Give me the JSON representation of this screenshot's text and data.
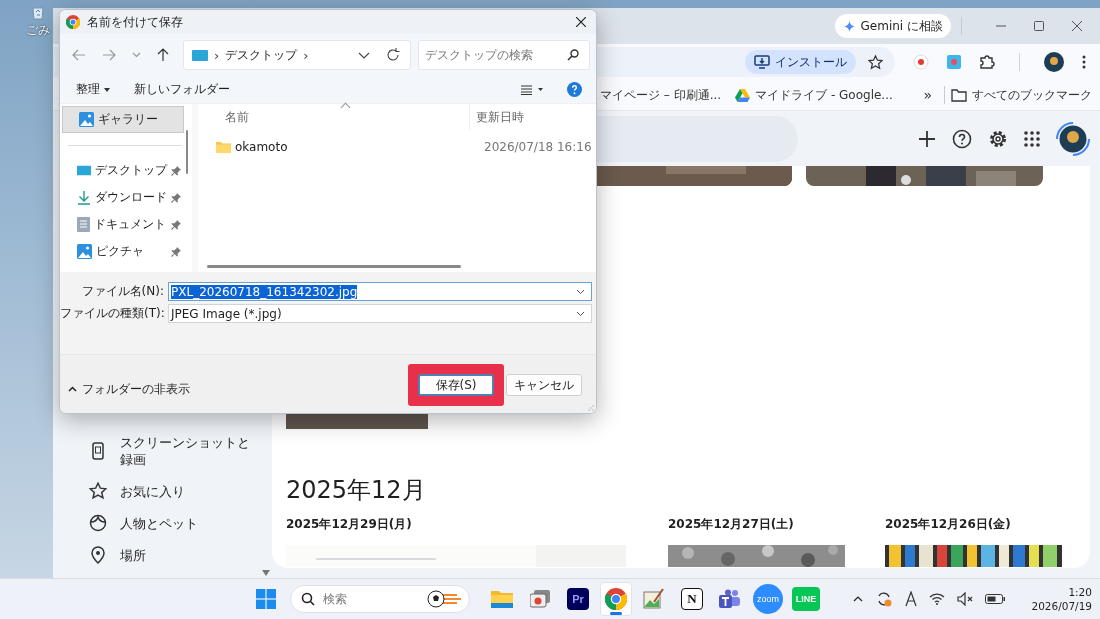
{
  "desktop": {
    "icon_label": "ごみ"
  },
  "browser": {
    "gemini_button": "Gemini に相談",
    "install_button": "インストール",
    "bookmarks": [
      {
        "label": "マイページ – 印刷通...",
        "kind": "page"
      },
      {
        "label": "マイドライブ - Google...",
        "kind": "drive"
      }
    ],
    "overflow": "»",
    "all_bookmarks": "すべてのブックマーク"
  },
  "photos": {
    "sidebar": [
      {
        "label": "スクリーンショットと録画",
        "kind": "screenshot"
      },
      {
        "label": "お気に入り",
        "kind": "favorite"
      },
      {
        "label": "人物とペット",
        "kind": "people"
      },
      {
        "label": "場所",
        "kind": "place"
      }
    ],
    "month": "2025年12月",
    "days": [
      "2025年12月29日(月)",
      "2025年12月27日(土)",
      "2025年12月26日(金)"
    ]
  },
  "dialog": {
    "title": "名前を付けて保存",
    "breadcrumb": [
      "›",
      "デスクトップ",
      "›"
    ],
    "search_placeholder": "デスクトップの検索",
    "organize": "整理",
    "new_folder": "新しいフォルダー",
    "nav": [
      {
        "label": "ギャラリー",
        "kind": "gallery",
        "selected": true,
        "pinned": false
      },
      {
        "label": "デスクトップ",
        "kind": "desktop",
        "selected": false,
        "pinned": true
      },
      {
        "label": "ダウンロード",
        "kind": "download",
        "selected": false,
        "pinned": true
      },
      {
        "label": "ドキュメント",
        "kind": "document",
        "selected": false,
        "pinned": true
      },
      {
        "label": "ピクチャ",
        "kind": "picture",
        "selected": false,
        "pinned": true
      }
    ],
    "columns": [
      "名前",
      "更新日時"
    ],
    "files": [
      {
        "name": "okamoto",
        "modified": "2026/07/18 16:16"
      }
    ],
    "filename_label": "ファイル名(N):",
    "filename": "PXL_20260718_161342302.jpg",
    "filetype_label": "ファイルの種類(T):",
    "filetype": "JPEG Image (*.jpg)",
    "hide_folders": "フォルダーの非表示",
    "save": "保存(S)",
    "cancel": "キャンセル"
  },
  "taskbar": {
    "search_placeholder": "検索",
    "apps": [
      {
        "kind": "explorer",
        "selected": false
      },
      {
        "kind": "gallery",
        "selected": false
      },
      {
        "kind": "premiere",
        "label": "Pr",
        "selected": false
      },
      {
        "kind": "chrome",
        "selected": true
      },
      {
        "kind": "paint",
        "selected": false
      },
      {
        "kind": "notion",
        "label": "N",
        "selected": false
      },
      {
        "kind": "teams",
        "selected": false
      },
      {
        "kind": "zoom",
        "label": "zoom",
        "selected": false
      },
      {
        "kind": "line",
        "label": "LINE",
        "selected": false
      }
    ],
    "time": "1:20",
    "date": "2026/07/19"
  }
}
